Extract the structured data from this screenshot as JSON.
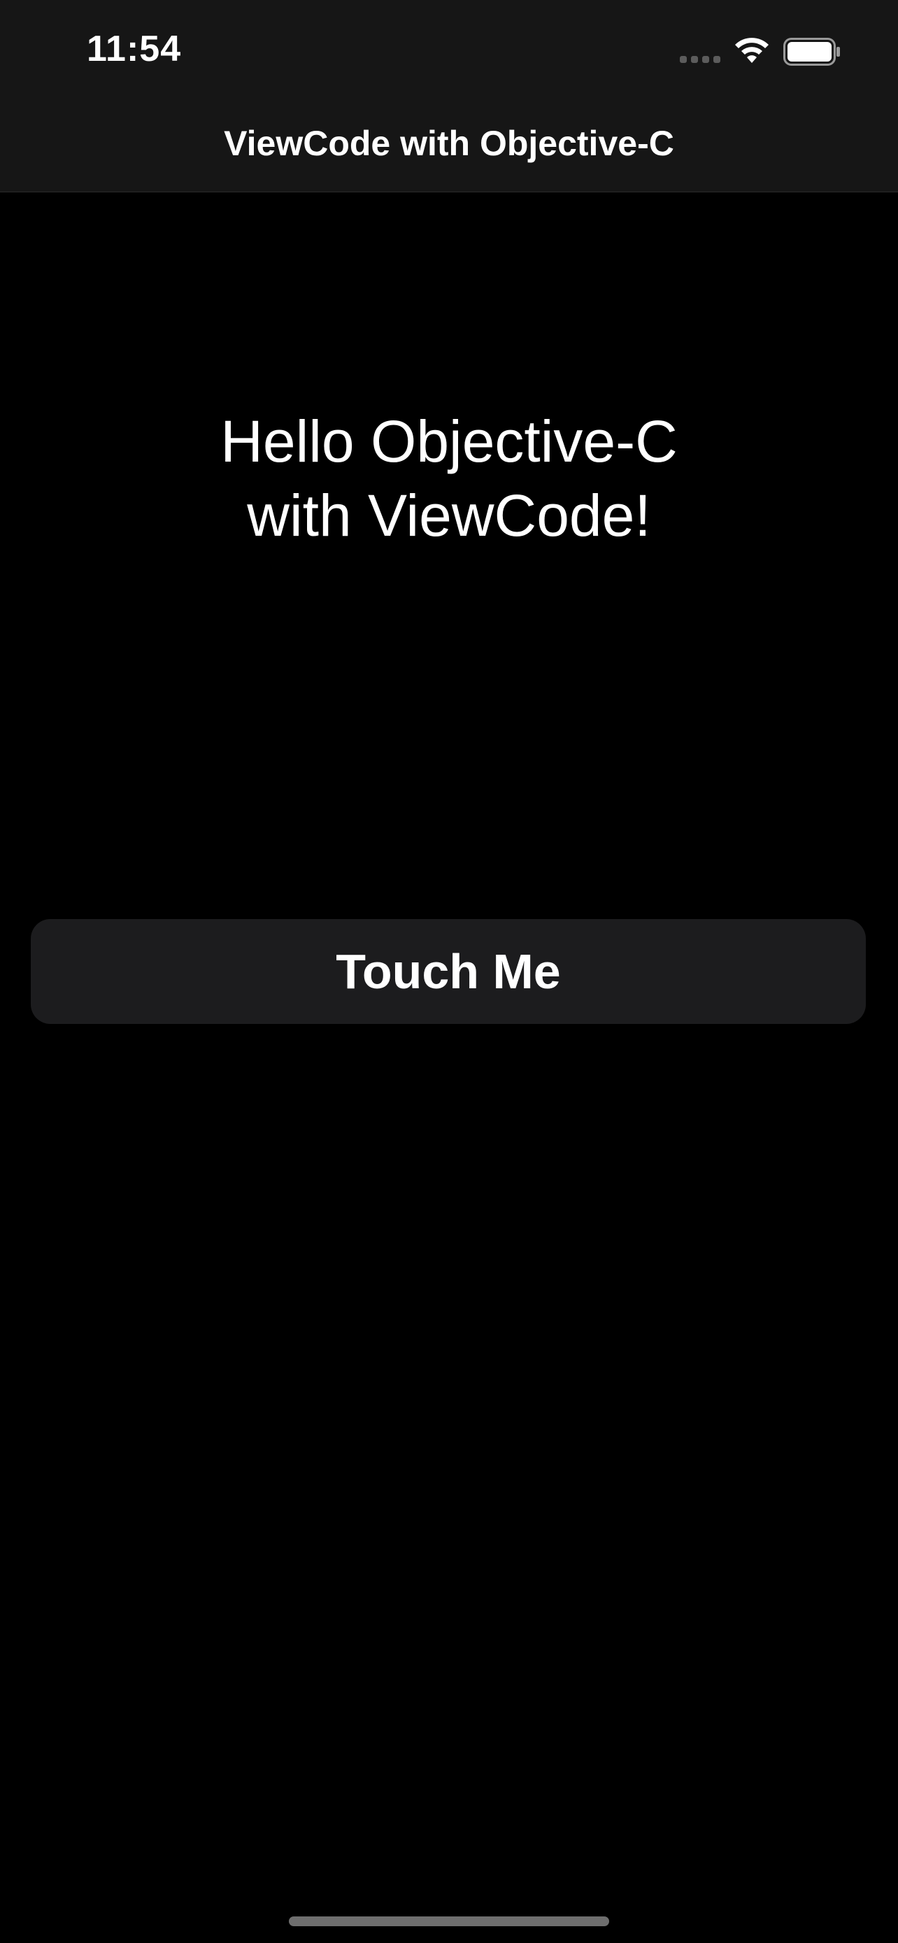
{
  "status_bar": {
    "time": "11:54",
    "icons": [
      "cellular-signal-icon",
      "wifi-icon",
      "battery-icon"
    ]
  },
  "navigation": {
    "title": "ViewCode with Objective-C"
  },
  "main": {
    "hello_line_1": "Hello Objective-C",
    "hello_line_2": "with ViewCode!",
    "button_label": "Touch Me"
  },
  "colors": {
    "background": "#000000",
    "nav_background": "#161616",
    "button_background": "#1c1c1e",
    "text": "#ffffff"
  }
}
